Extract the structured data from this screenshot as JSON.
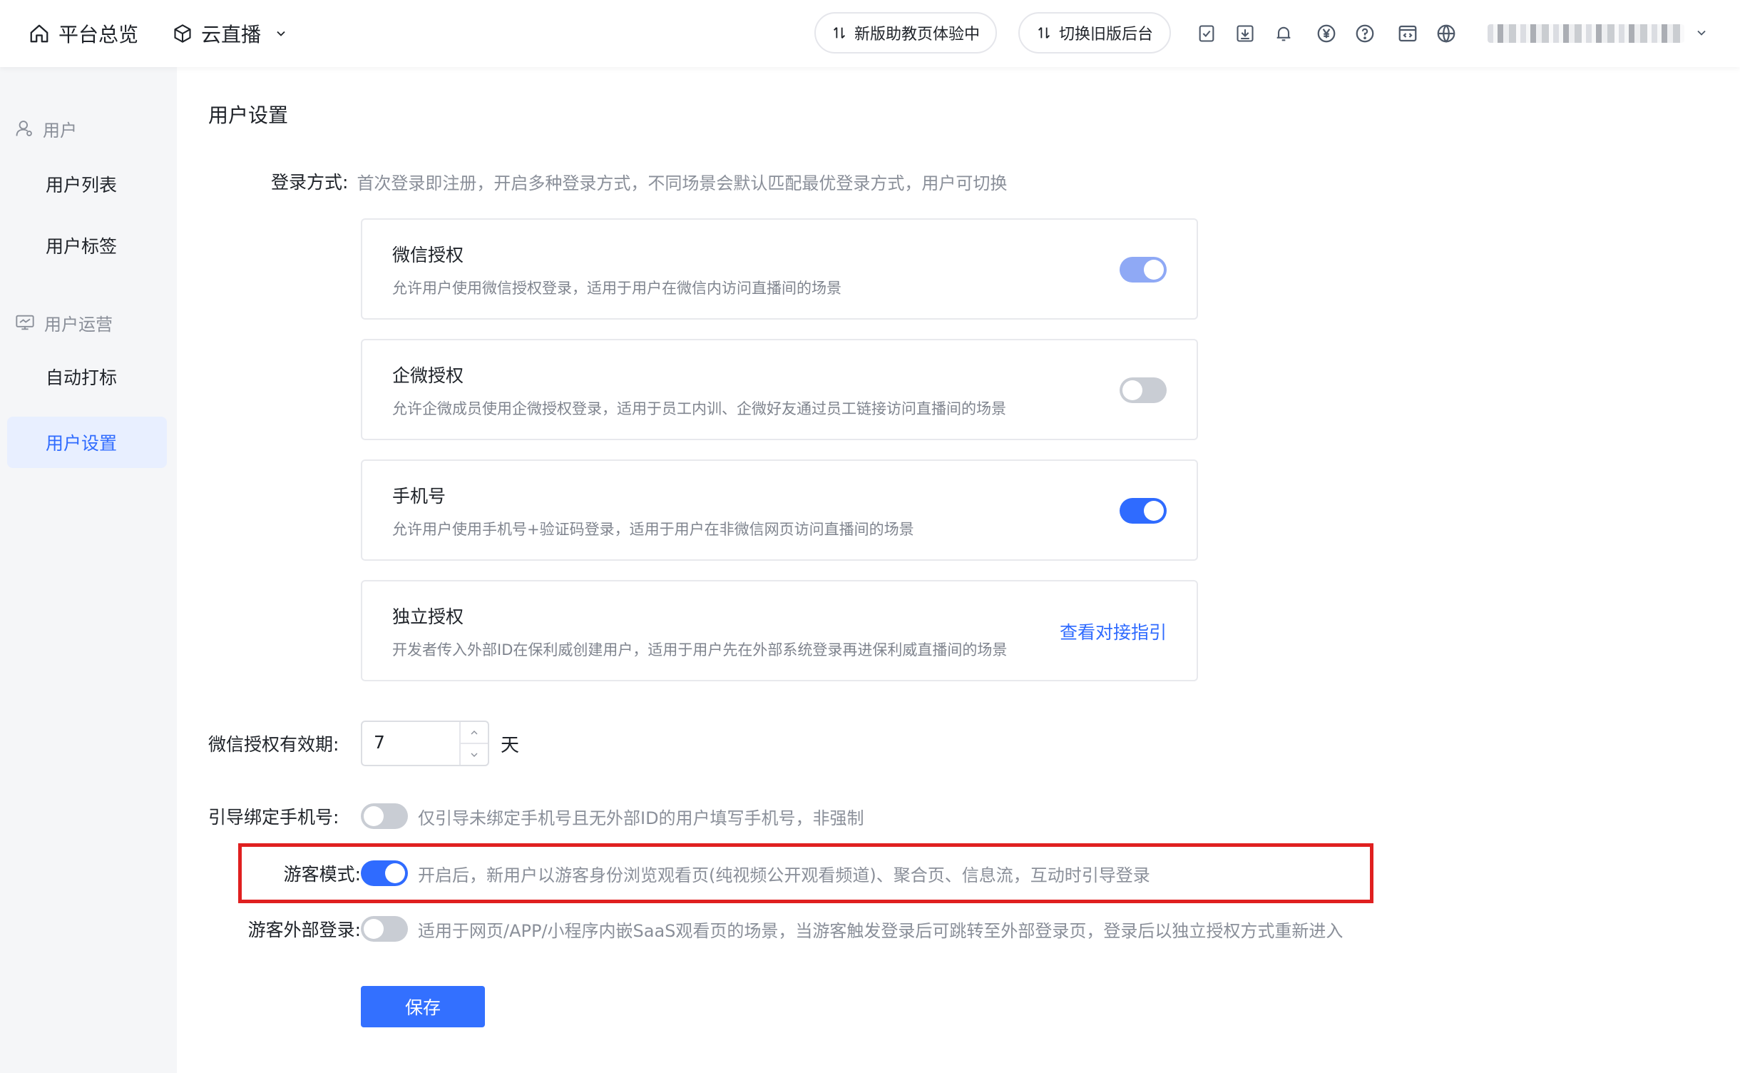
{
  "topbar": {
    "home_label": "平台总览",
    "product_label": "云直播",
    "pill_new_label": "新版助教页体验中",
    "pill_old_label": "切换旧版后台",
    "icons": [
      "checklist-icon",
      "download-icon",
      "bell-icon",
      "yen-icon",
      "help-icon",
      "code-window-icon",
      "globe-icon"
    ]
  },
  "sidebar": {
    "groups": [
      {
        "title": "用户",
        "icon": "user-icon",
        "items": [
          "用户列表",
          "用户标签"
        ]
      },
      {
        "title": "用户运营",
        "icon": "monitor-chart-icon",
        "items": [
          "自动打标",
          "用户设置"
        ]
      }
    ],
    "active_item": "用户设置"
  },
  "main": {
    "page_title": "用户设置",
    "login": {
      "label": "登录方式:",
      "hint": "首次登录即注册，开启多种登录方式，不同场景会默认匹配最优登录方式，用户可切换",
      "cards": [
        {
          "title": "微信授权",
          "desc": "允许用户使用微信授权登录，适用于用户在微信内访问直播间的场景",
          "enabled": true
        },
        {
          "title": "企微授权",
          "desc": "允许企微成员使用企微授权登录，适用于员工内训、企微好友通过员工链接访问直播间的场景",
          "enabled": false
        },
        {
          "title": "手机号",
          "desc": "允许用户使用手机号+验证码登录，适用于用户在非微信网页访问直播间的场景",
          "enabled": true
        },
        {
          "title": "独立授权",
          "desc": "开发者传入外部ID在保利威创建用户，适用于用户先在外部系统登录再进保利威直播间的场景",
          "link": "查看对接指引"
        }
      ]
    },
    "wechat_validity": {
      "label": "微信授权有效期:",
      "value": "7",
      "unit": "天"
    },
    "bind_phone": {
      "label": "引导绑定手机号:",
      "enabled": false,
      "hint": "仅引导未绑定手机号且无外部ID的用户填写手机号，非强制"
    },
    "guest_mode": {
      "label": "游客模式:",
      "enabled": true,
      "hint": "开启后，新用户以游客身份浏览观看页(纯视频公开观看频道)、聚合页、信息流，互动时引导登录"
    },
    "guest_external": {
      "label": "游客外部登录:",
      "enabled": false,
      "hint": "适用于网页/APP/小程序内嵌SaaS观看页的场景，当游客触发登录后可跳转至外部登录页，登录后以独立授权方式重新进入"
    },
    "save_label": "保存"
  },
  "colors": {
    "primary": "#3370ff",
    "highlight": "#e02020",
    "muted": "#8a8f99"
  }
}
